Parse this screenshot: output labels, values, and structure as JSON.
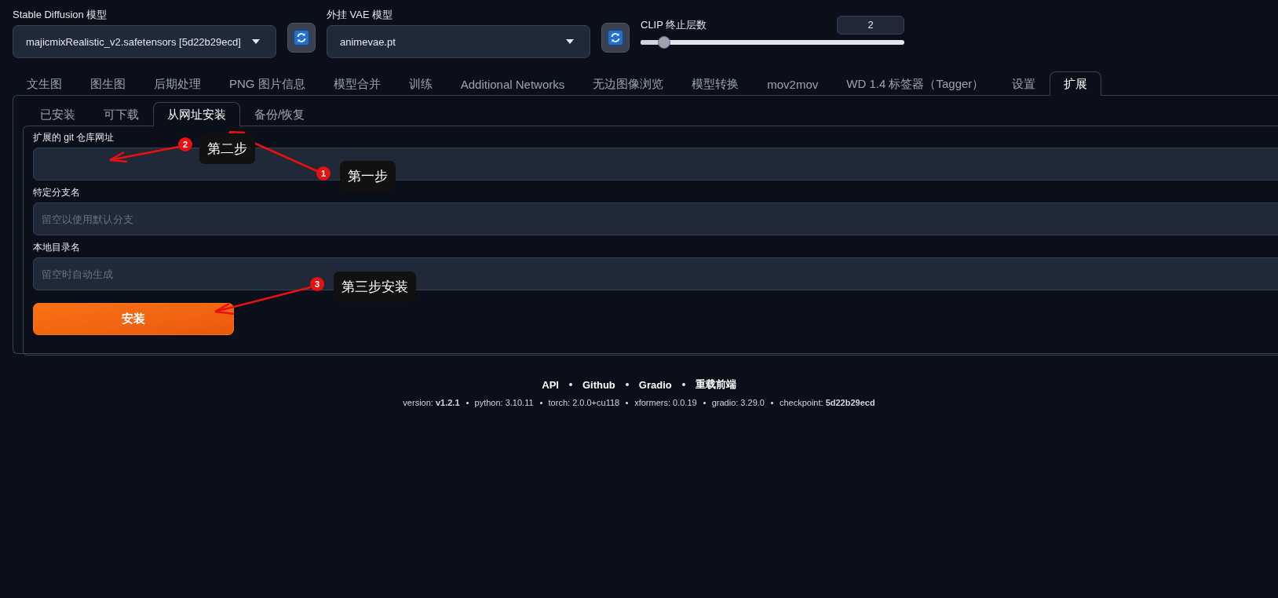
{
  "model_selectors": [
    {
      "label": "Stable Diffusion 模型",
      "value": "majicmixRealistic_v2.safetensors [5d22b29ecd]"
    },
    {
      "label": "外挂 VAE 模型",
      "value": "animevae.pt"
    }
  ],
  "clip_skip": {
    "label": "CLIP 终止层数",
    "value": "2",
    "level": 0.09
  },
  "main_tabs": [
    {
      "label": "文生图",
      "selected": false
    },
    {
      "label": "图生图",
      "selected": false
    },
    {
      "label": "后期处理",
      "selected": false
    },
    {
      "label": "PNG 图片信息",
      "selected": false
    },
    {
      "label": "模型合并",
      "selected": false
    },
    {
      "label": "训练",
      "selected": false
    },
    {
      "label": "Additional Networks",
      "selected": false
    },
    {
      "label": "无边图像浏览",
      "selected": false
    },
    {
      "label": "模型转换",
      "selected": false
    },
    {
      "label": "mov2mov",
      "selected": false
    },
    {
      "label": "WD 1.4 标签器（Tagger）",
      "selected": false
    },
    {
      "label": "设置",
      "selected": false
    },
    {
      "label": "扩展",
      "selected": true
    }
  ],
  "sub_tabs": [
    {
      "label": "已安装",
      "selected": false
    },
    {
      "label": "可下载",
      "selected": false
    },
    {
      "label": "从网址安装",
      "selected": true
    },
    {
      "label": "备份/恢复",
      "selected": false
    }
  ],
  "fields": [
    {
      "label": "扩展的 git 仓库网址"
    },
    {
      "label": "特定分支名",
      "placeholder": "留空以使用默认分支"
    },
    {
      "label": "本地目录名",
      "placeholder": "留空时自动生成"
    }
  ],
  "install_button": "安装",
  "footer": {
    "links": [
      "API",
      "Github",
      "Gradio",
      "重载前端"
    ],
    "versions": [
      "version: **v1.2.1**",
      "python: 3.10.11",
      "torch: 2.0.0+cu118",
      "xformers: 0.0.19",
      "gradio: 3.29.0",
      "checkpoint: **5d22b29ecd**"
    ]
  },
  "annotations": [
    {
      "number": "1",
      "text": "第一步"
    },
    {
      "number": "2",
      "text": "第二步"
    },
    {
      "number": "3",
      "text": "第三步安装"
    }
  ]
}
